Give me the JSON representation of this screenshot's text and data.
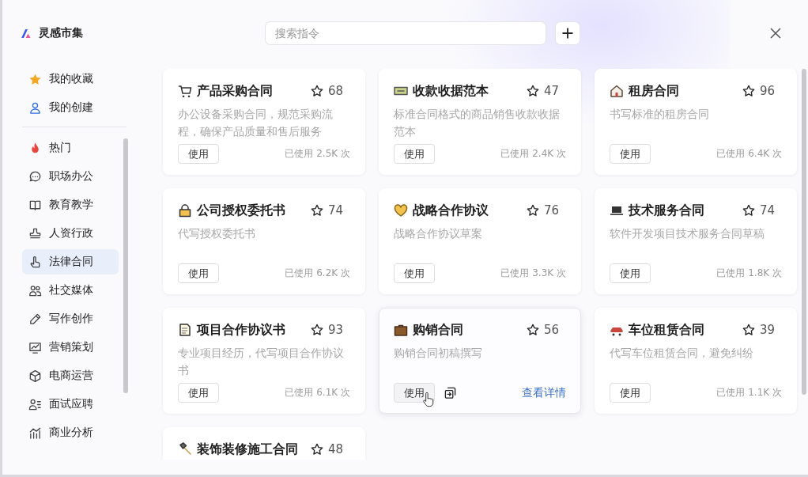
{
  "app": {
    "title": "灵感市集"
  },
  "search": {
    "placeholder": "搜索指令"
  },
  "sidebar": {
    "favorites": [
      {
        "label": "我的收藏",
        "selected": false
      },
      {
        "label": "我的创建",
        "selected": false
      }
    ],
    "categories": [
      {
        "label": "热门",
        "selected": false
      },
      {
        "label": "职场办公",
        "selected": false
      },
      {
        "label": "教育教学",
        "selected": false
      },
      {
        "label": "人资行政",
        "selected": false
      },
      {
        "label": "法律合同",
        "selected": true
      },
      {
        "label": "社交媒体",
        "selected": false
      },
      {
        "label": "写作创作",
        "selected": false
      },
      {
        "label": "营销策划",
        "selected": false
      },
      {
        "label": "电商运营",
        "selected": false
      },
      {
        "label": "面试应聘",
        "selected": false
      },
      {
        "label": "商业分析",
        "selected": false
      }
    ]
  },
  "cards": [
    {
      "title": "产品采购合同",
      "favorite_count": "68",
      "description": "办公设备采购合同，规范采购流程，确保产品质量和售后服务",
      "use_button": "使用",
      "usage": "已使用 2.5K 次",
      "hovered": false
    },
    {
      "title": "收款收据范本",
      "favorite_count": "47",
      "description": "标准合同格式的商品销售收款收据范本",
      "use_button": "使用",
      "usage": "已使用 2.4K 次",
      "hovered": false
    },
    {
      "title": "租房合同",
      "favorite_count": "96",
      "description": "书写标准的租房合同",
      "use_button": "使用",
      "usage": "已使用 6.4K 次",
      "hovered": false
    },
    {
      "title": "公司授权委托书",
      "favorite_count": "74",
      "description": "代写授权委托书",
      "use_button": "使用",
      "usage": "已使用 6.2K 次",
      "hovered": false
    },
    {
      "title": "战略合作协议",
      "favorite_count": "76",
      "description": "战略合作协议草案",
      "use_button": "使用",
      "usage": "已使用 3.3K 次",
      "hovered": false
    },
    {
      "title": "技术服务合同",
      "favorite_count": "74",
      "description": "软件开发项目技术服务合同草稿",
      "use_button": "使用",
      "usage": "已使用 1.8K 次",
      "hovered": false
    },
    {
      "title": "项目合作协议书",
      "favorite_count": "93",
      "description": "专业项目经历，代写项目合作协议书",
      "use_button": "使用",
      "usage": "已使用 6.1K 次",
      "hovered": false
    },
    {
      "title": "购销合同",
      "favorite_count": "56",
      "description": "购销合同初稿撰写",
      "use_button": "使用",
      "detail_link": "查看详情",
      "hovered": true
    },
    {
      "title": "车位租赁合同",
      "favorite_count": "39",
      "description": "代写车位租赁合同，避免纠纷",
      "use_button": "使用",
      "usage": "已使用 1.1K 次",
      "hovered": false
    },
    {
      "title": "装饰装修施工合同",
      "favorite_count": "48",
      "hovered": false
    }
  ]
}
